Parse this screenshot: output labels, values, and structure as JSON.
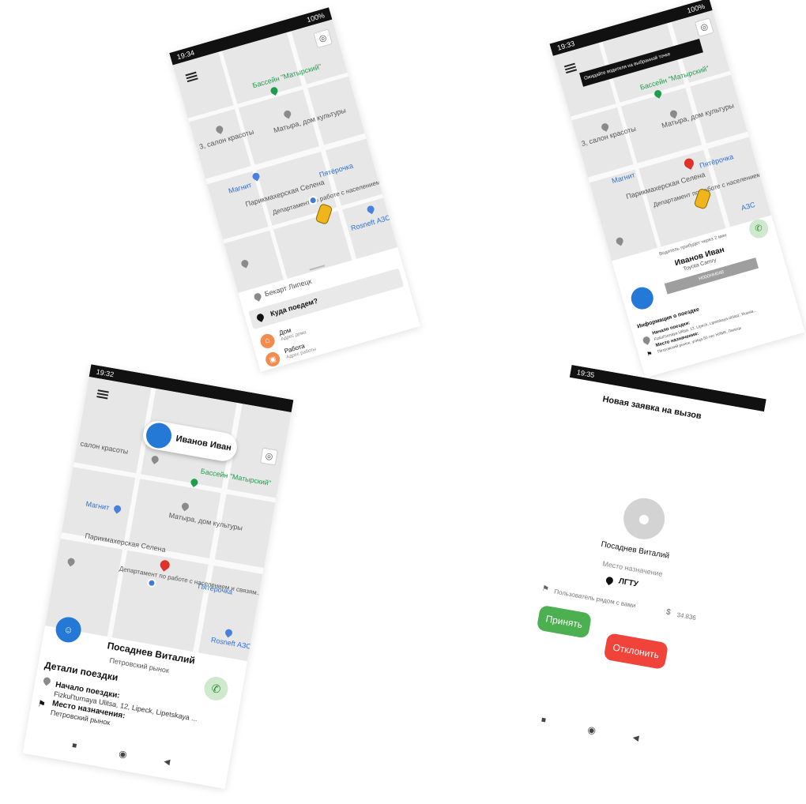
{
  "screen1": {
    "status_time": "19:34",
    "status_right": "100%",
    "map_labels": {
      "basin": "Бассейн \"Матырский\"",
      "salon": "3, салон красоты",
      "culture": "Матыра, дом культуры",
      "magnit": "Магнит",
      "parikmaher": "Парикмахерская Селена",
      "department": "Департамент по работе с населением и связям...",
      "pyaterochka": "Пятёрочка",
      "rosneft": "Rosneft АЗС",
      "bekart": "Бекарт Липецк"
    },
    "where_to": "Куда поедем?",
    "places": [
      {
        "name": "Дом",
        "sub": "Адрес дома",
        "icon": "home-icon"
      },
      {
        "name": "Работа",
        "sub": "Адрес работы",
        "icon": "briefcase-icon"
      }
    ]
  },
  "screen2": {
    "status_time": "19:33",
    "status_right": "100%",
    "toast": "Ожидайте водителя на выбранной точке",
    "map_labels": {
      "basin": "Бассейн \"Матырский\"",
      "salon": "3, салон красоты",
      "culture": "Матыра, дом культуры",
      "magnit": "Магнит",
      "parikmaher": "Парикмахерская Селена",
      "department": "Департамент по работе с населением и связям...",
      "pyaterochka": "Пятёрочка",
      "rosneft": "АЗС"
    },
    "arrive_note": "Водитель прибудет через 2 мин",
    "driver_name": "Иванов Иван",
    "car_model": "Toyota Camry",
    "plate": "Н000НН048",
    "trip_info_title": "Информация о поездке",
    "start_label": "Начало поездки:",
    "start_value": "Fizkul'turnaya Ulitsa, 12, Lipeck, Lipetskaya oblast', Russia...",
    "dest_label": "Место назначения:",
    "dest_value": "Петровский рынок, улица 50 лет НЛМК, Липецк"
  },
  "screen3": {
    "status_time": "19:32",
    "driver_card_name": "Иванов Иван",
    "map_labels": {
      "salon": "салон красоты",
      "basin": "Бассейн \"Матырский\"",
      "culture": "Матыра, дом культуры",
      "magnit": "Магнит",
      "parikmaher": "Парикмахерская Селена",
      "department": "Департамент по работе с населением и связям...",
      "pyaterochka": "Пятёрочка",
      "rosneft": "Rosneft АЗС"
    },
    "passenger_name": "Посаднев Виталий",
    "passenger_dest": "Петровский рынок",
    "details_title": "Детали поездки",
    "start_label": "Начало поездки:",
    "start_value": "Fizkul'turnaya Ulitsa, 12, Lipeck, Lipetskaya ...",
    "dest_label": "Место назначения:",
    "dest_value": "Петровский рынок"
  },
  "screen4": {
    "status_time": "19:35",
    "title": "Новая заявка на вызов",
    "passenger_name": "Посаднев Виталий",
    "dest_caption": "Место назначение",
    "dest_value": "ЛГТУ",
    "nearby": "Пользователь рядом с вами",
    "price": "34.836",
    "accept": "Принять",
    "decline": "Отклонить"
  },
  "colors": {
    "accent_blue": "#2479d6",
    "accept_green": "#4caf50",
    "decline_red": "#f0433a",
    "call_green_bg": "#cfe9cf",
    "home_orange": "#f28c4e"
  }
}
